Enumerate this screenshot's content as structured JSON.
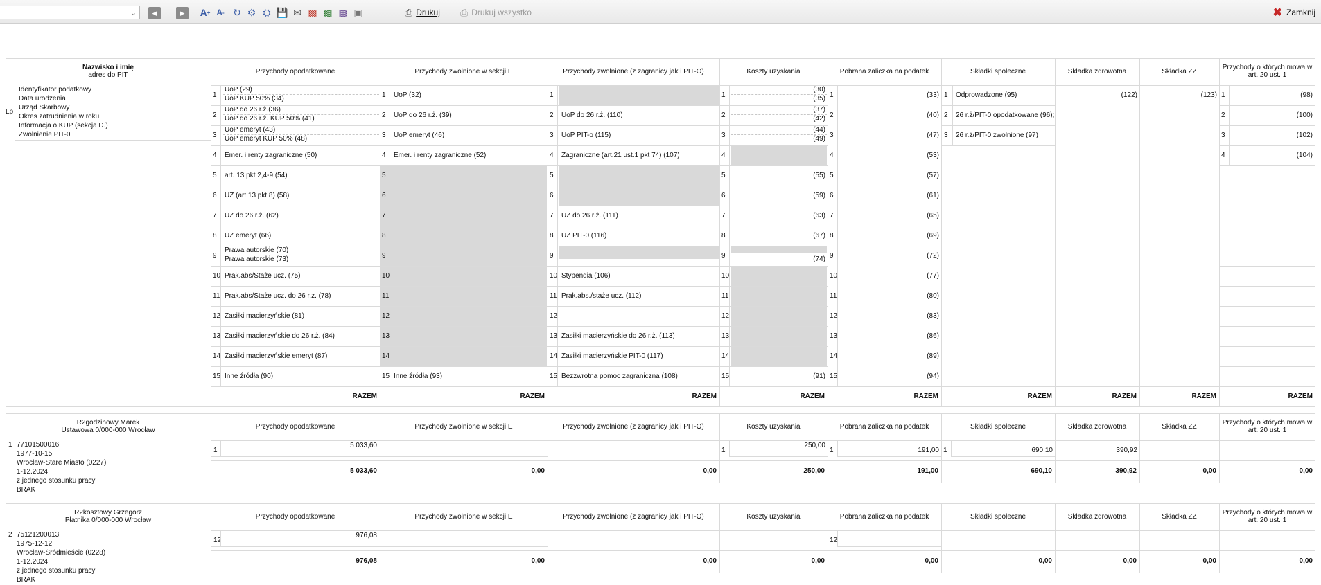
{
  "toolbar": {
    "print_label": "Drukuj",
    "print_all_label": "Drukuj wszystko",
    "close_label": "Zamknij"
  },
  "header": {
    "name_title": "Nazwisko i imię",
    "name_sub": "adres do PIT",
    "lp": "Lp",
    "person_fields": [
      "Identyfikator podatkowy",
      "Data urodzenia",
      "Urząd Skarbowy",
      "Okres zatrudnienia w roku",
      "Informacja o KUP (sekcja D.)",
      "Zwolnienie PIT-0"
    ],
    "columns": [
      "Przychody opodatkowane",
      "Przychody zwolnione w sekcji E",
      "Przychody zwolnione (z zagranicy jak i PIT-O)",
      "Koszty uzyskania",
      "Pobrana zaliczka na podatek",
      "Składki społeczne",
      "Składka zdrowotna",
      "Składka ZZ",
      "Przychody o których mowa w art. 20 ust. 1"
    ],
    "razem": "RAZEM"
  },
  "col1": [
    [
      "UoP (29)",
      "UoP KUP 50% (34)"
    ],
    [
      "UoP do 26 r.ż.(36)",
      "UoP do 26 r.ż. KUP 50% (41)"
    ],
    [
      "UoP emeryt (43)",
      "UoP emeryt KUP 50% (48)"
    ],
    [
      "Emer. i renty zagraniczne (50)"
    ],
    [
      "art. 13 pkt 2,4-9 (54)"
    ],
    [
      "UZ (art.13 pkt 8) (58)"
    ],
    [
      "UZ do 26 r.ż. (62)"
    ],
    [
      "UZ emeryt (66)"
    ],
    [
      "Prawa autorskie (70)",
      "Prawa autorskie (73)"
    ],
    [
      "Prak.abs/Staże ucz. (75)"
    ],
    [
      "Prak.abs/Staże ucz. do 26 r.ż. (78)"
    ],
    [
      "Zasiłki macierzyńskie (81)"
    ],
    [
      "Zasiłki macierzyńskie do 26 r.ż. (84)"
    ],
    [
      "Zasiłki macierzyńskie emeryt (87)"
    ],
    [
      "Inne źródła (90)"
    ]
  ],
  "col2": [
    "UoP (32)",
    "UoP do 26 r.ż. (39)",
    "UoP emeryt (46)",
    "Emer. i renty zagraniczne (52)",
    "",
    "",
    "",
    "",
    "",
    "",
    "",
    "",
    "",
    "",
    "Inne źródła (93)"
  ],
  "col3": [
    "",
    "UoP do 26 r.ż. (110)",
    "UoP PIT-o (115)",
    "Zagraniczne (art.21 ust.1 pkt 74) (107)",
    "",
    "",
    "UZ do 26 r.ż. (111)",
    "UZ PIT-0 (116)",
    "",
    "Stypendia (106)",
    "Prak.abs./staże ucz. (112)",
    "",
    "Zasiłki macierzyńskie do 26 r.ż. (113)",
    "Zasiłki macierzyńskie PIT-0 (117)",
    "Bezzwrotna pomoc zagraniczna (108)"
  ],
  "col4": [
    [
      "(30)",
      "(35)"
    ],
    [
      "(37)",
      "(42)"
    ],
    [
      "(44)",
      "(49)"
    ],
    [
      ""
    ],
    [
      "(55)"
    ],
    [
      "(59)"
    ],
    [
      "(63)"
    ],
    [
      "(67)"
    ],
    [
      "",
      "(74)"
    ],
    [
      ""
    ],
    [
      ""
    ],
    [
      ""
    ],
    [
      ""
    ],
    [
      ""
    ],
    [
      "(91)"
    ]
  ],
  "col5": [
    "(33)",
    "(40)",
    "(47)",
    "(53)",
    "(57)",
    "(61)",
    "(65)",
    "(69)",
    "(72)",
    "(77)",
    "(80)",
    "(83)",
    "(86)",
    "(89)",
    "(94)"
  ],
  "col6": [
    "Odprowadzone (95)",
    "26 r.ż/PIT-0 opodatkowane (96);",
    "26 r.ż/PIT-0 zwolnione (97)"
  ],
  "col7": "(122)",
  "col8": "(123)",
  "col9": [
    "(98)",
    "(100)",
    "(102)",
    "(104)"
  ],
  "row_nums": [
    "1",
    "2",
    "3",
    "4",
    "5",
    "6",
    "7",
    "8",
    "9",
    "10",
    "11",
    "12",
    "13",
    "14",
    "15"
  ],
  "employees": [
    {
      "lp": "1",
      "name": "R2godzinowy Marek",
      "address": "Ustawowa 0/000-000 Wrocław",
      "fields": [
        "77101500016",
        "1977-10-15",
        "Wrocław-Stare Miasto (0227)",
        "1-12.2024",
        "z jednego stosunku pracy",
        "BRAK"
      ],
      "entry": {
        "c1_num": "1",
        "c1_val": "5 033,60",
        "c4_num": "1",
        "c4_val": "250,00",
        "c5_num": "1",
        "c5_val": "191,00",
        "c6_num": "1",
        "c6_val": "690,10",
        "c7_val": "390,92"
      },
      "totals": [
        "5 033,60",
        "0,00",
        "0,00",
        "250,00",
        "191,00",
        "690,10",
        "390,92",
        "0,00",
        "0,00"
      ]
    },
    {
      "lp": "2",
      "name": "R2kosztowy Grzegorz",
      "address": "Płatnika 0/000-000 Wrocław",
      "fields": [
        "75121200013",
        "1975-12-12",
        "Wrocław-Śródmieście (0228)",
        "1-12.2024",
        "z jednego stosunku pracy",
        "BRAK"
      ],
      "entry": {
        "c1_num": "12",
        "c1_val": "976,08",
        "c5_num": "12"
      },
      "totals": [
        "976,08",
        "0,00",
        "0,00",
        "0,00",
        "0,00",
        "0,00",
        "0,00",
        "0,00",
        "0,00"
      ]
    }
  ]
}
